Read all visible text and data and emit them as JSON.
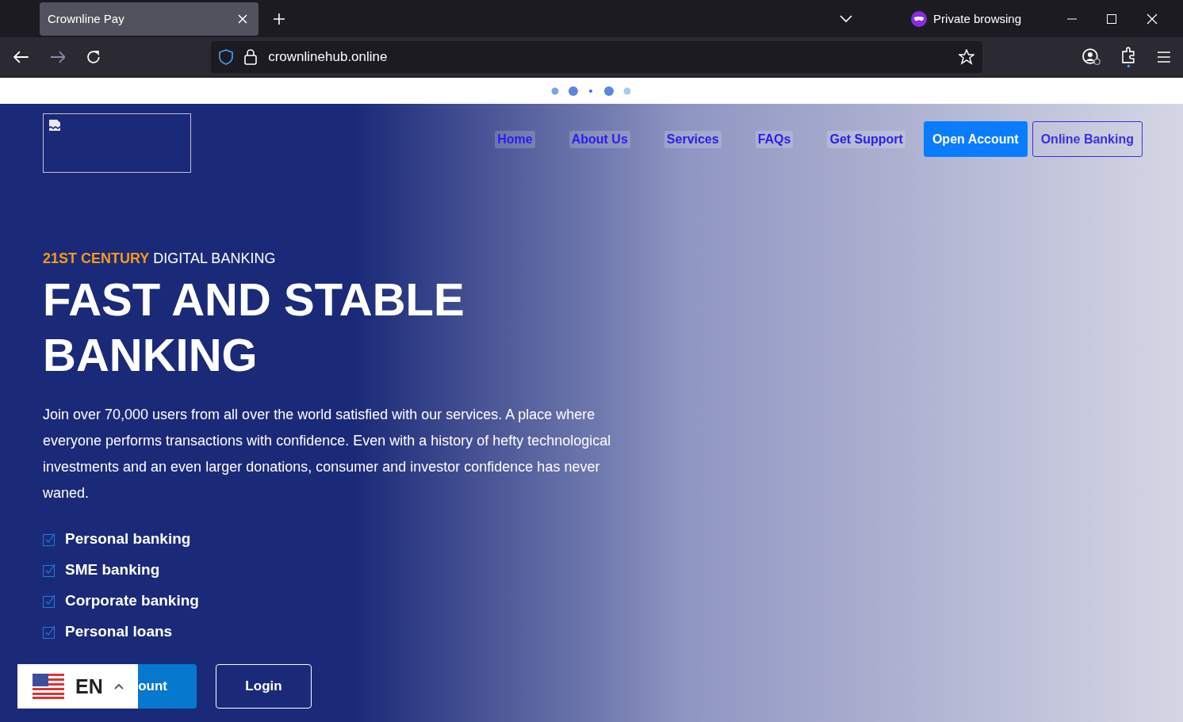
{
  "browser": {
    "tab_title": "Crownline Pay",
    "private_label": "Private browsing",
    "url": "crownlinehub.online"
  },
  "nav": {
    "links": [
      {
        "label": "Home"
      },
      {
        "label": "About Us"
      },
      {
        "label": "Services"
      },
      {
        "label": "FAQs"
      },
      {
        "label": "Get Support"
      }
    ],
    "buttons": [
      {
        "label": "Open Account",
        "kind": "primary"
      },
      {
        "label": "Online Banking",
        "kind": "outline"
      }
    ]
  },
  "hero": {
    "eyebrow_accent": "21ST CENTURY",
    "eyebrow": "DIGITAL BANKING",
    "title": "FAST AND STABLE BANKING",
    "description": "Join over 70,000 users from all over the world satisfied with our services. A place where everyone performs transactions with confidence. Even with a history of hefty technological investments and an even larger donations, consumer and investor confidence has never waned.",
    "features": [
      {
        "label": "Personal banking",
        "checked": true
      },
      {
        "label": "SME banking",
        "checked": true
      },
      {
        "label": "Corporate banking",
        "checked": true
      },
      {
        "label": "Personal loans",
        "checked": true
      }
    ],
    "buttons": [
      {
        "label": "ount",
        "kind": "primary"
      },
      {
        "label": "Login",
        "kind": "outline"
      }
    ]
  },
  "language": {
    "code": "EN"
  }
}
